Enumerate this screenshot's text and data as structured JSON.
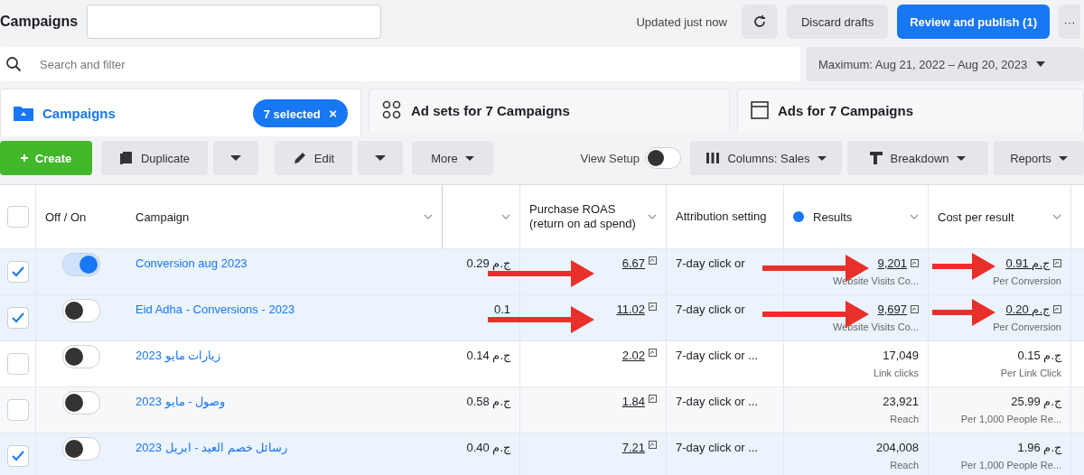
{
  "header": {
    "title": "Campaigns",
    "status": "Updated just now",
    "discard": "Discard drafts",
    "publish": "Review and publish (1)",
    "more": "···"
  },
  "search": {
    "placeholder": "Search and filter",
    "date_range": "Maximum: Aug 21, 2022 – Aug 20, 2023"
  },
  "tabs": [
    {
      "kind": "folder",
      "label": "Campaigns",
      "selected": true,
      "badge": "7 selected",
      "badge_close": "×"
    },
    {
      "kind": "adsets",
      "label": "Ad sets for 7 Campaigns",
      "selected": false
    },
    {
      "kind": "ads",
      "label": "Ads for 7 Campaigns",
      "selected": false
    }
  ],
  "toolbar": {
    "create": "Create",
    "duplicate": "Duplicate",
    "edit": "Edit",
    "more": "More",
    "view_setup": {
      "label": "View Setup",
      "on": false
    },
    "columns": "Columns: Sales",
    "breakdown": "Breakdown",
    "reports": "Reports"
  },
  "table": {
    "all_selected": false,
    "columns": [
      "Off / On",
      "Campaign",
      "Purchase ROAS (return on ad spend)",
      "Attribution setting",
      "Results",
      "Cost per result"
    ],
    "rows": [
      {
        "selected": true,
        "on": true,
        "highlighted": true,
        "campaign": "Conversion aug 2023",
        "column_4": "0.29 ج.م",
        "roas": "6.67",
        "attribution": "7-day click or",
        "results": "9,201",
        "results_sub": "Website Visits Co...",
        "cost": "0.91 ج.م",
        "cost_sub": "Per Conversion"
      },
      {
        "selected": true,
        "on": false,
        "highlighted": true,
        "campaign": "Eid Adha - Conversions - 2023",
        "column_4": "0.1",
        "roas": "11.02",
        "attribution": "7-day click or",
        "results": "9,697",
        "results_sub": "Website Visits Co...",
        "cost": "0.20 ج.م",
        "cost_sub": "Per Conversion"
      },
      {
        "selected": false,
        "on": false,
        "highlighted": false,
        "campaign": "زيارات مايو 2023",
        "column_4": "0.14 ج.م",
        "roas": "2.02",
        "attribution": "7-day click or ...",
        "results": "17,049",
        "results_sub": "Link clicks",
        "cost": "0.15 ج.م",
        "cost_sub": "Per Link Click"
      },
      {
        "selected": false,
        "on": false,
        "highlighted": false,
        "campaign": "وصول - مايو 2023",
        "column_4": "0.58 ج.م",
        "roas": "1.84",
        "attribution": "7-day click or ...",
        "results": "23,921",
        "results_sub": "Reach",
        "cost": "25.99 ج.م",
        "cost_sub": "Per 1,000 People Re..."
      },
      {
        "selected": true,
        "on": false,
        "highlighted": false,
        "campaign": "رسائل خصم العيد - ابريل 2023",
        "column_4": "0.40 ج.م",
        "roas": "7.21",
        "attribution": "7-day click or ...",
        "results": "204,008",
        "results_sub": "Reach",
        "cost": "1.96 ج.م",
        "cost_sub": "Per 1,000 People Re..."
      }
    ]
  }
}
